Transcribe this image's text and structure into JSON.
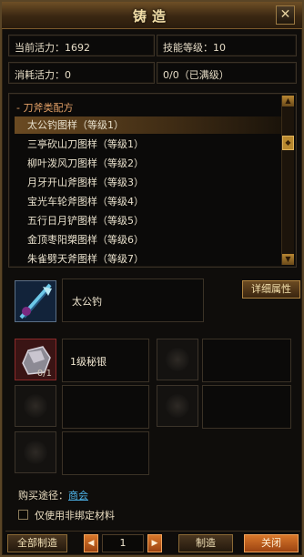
{
  "window": {
    "title": "铸造",
    "close_glyph": "✕"
  },
  "stats": {
    "current_vitality": "当前活力：1692",
    "skill_level": "技能等级：10",
    "consume_vitality": "消耗活力：0",
    "progress": "0/0（已满级）"
  },
  "recipes": {
    "category": "-  刀斧类配方",
    "items": [
      "太公钓图样（等级1）",
      "三亭砍山刀图样（等级1）",
      "柳叶泼风刀图样（等级2）",
      "月牙开山斧图样（等级3）",
      "宝光车轮斧图样（等级4）",
      "五行日月铲图样（等级5）",
      "金顶枣阳槊图样（等级6）",
      "朱雀劈天斧图样（等级7）"
    ],
    "selected_index": 0
  },
  "product": {
    "name": "太公钓",
    "detail_button": "详细属性"
  },
  "materials": [
    {
      "name": "1级秘银",
      "count": "0/1"
    }
  ],
  "purchase": {
    "label": "购买途径：",
    "link": "商会"
  },
  "options": {
    "unbound_only": "仅使用非绑定材料",
    "checked": false
  },
  "footer": {
    "craft_all": "全部制造",
    "quantity": "1",
    "prev_glyph": "◀",
    "next_glyph": "▶",
    "craft": "制造",
    "close": "关闭"
  },
  "icons": [
    "close-icon",
    "weapon-icon",
    "ore-icon",
    "arrow-left-icon",
    "arrow-right-icon"
  ],
  "colors": {
    "accent": "#e3a066",
    "link": "#4db2e8",
    "selected_row": "#6a4a22"
  }
}
